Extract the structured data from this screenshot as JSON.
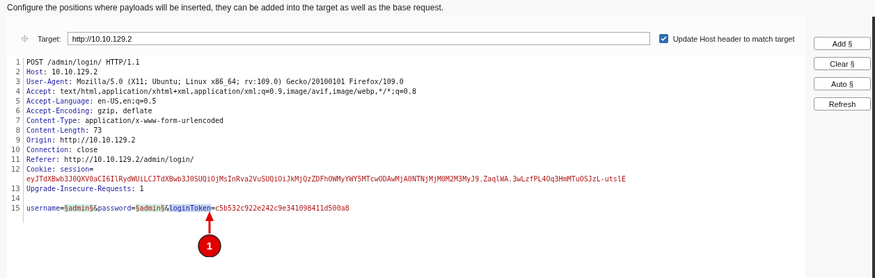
{
  "description": "Configure the positions where payloads will be inserted, they can be added into the target as well as the base request.",
  "target": {
    "label": "Target:",
    "value": "http://10.10.129.2"
  },
  "update_host": {
    "label": "Update Host header to match target",
    "checked": true
  },
  "buttons": [
    "Add §",
    "Clear §",
    "Auto §",
    "Refresh"
  ],
  "editor_lines": [
    {
      "number": "1",
      "segments": [
        {
          "kind": "plain",
          "text": "POST /admin/login/ HTTP/1.1"
        }
      ]
    },
    {
      "number": "2",
      "segments": [
        {
          "kind": "key",
          "text": "Host"
        },
        {
          "kind": "plain",
          "text": ": 10.10.129.2"
        }
      ]
    },
    {
      "number": "3",
      "segments": [
        {
          "kind": "key",
          "text": "User-Agent"
        },
        {
          "kind": "plain",
          "text": ": Mozilla/5.0 (X11; Ubuntu; Linux x86_64; rv:109.0) Gecko/20100101 Firefox/109.0"
        }
      ]
    },
    {
      "number": "4",
      "segments": [
        {
          "kind": "key",
          "text": "Accept"
        },
        {
          "kind": "plain",
          "text": ": text/html,application/xhtml+xml,application/xml;q=0.9,image/avif,image/webp,*/*;q=0.8"
        }
      ]
    },
    {
      "number": "5",
      "segments": [
        {
          "kind": "key",
          "text": "Accept-Language"
        },
        {
          "kind": "plain",
          "text": ": en-US,en;q=0.5"
        }
      ]
    },
    {
      "number": "6",
      "segments": [
        {
          "kind": "key",
          "text": "Accept-Encoding"
        },
        {
          "kind": "plain",
          "text": ": gzip, deflate"
        }
      ]
    },
    {
      "number": "7",
      "segments": [
        {
          "kind": "key",
          "text": "Content-Type"
        },
        {
          "kind": "plain",
          "text": ": application/x-www-form-urlencoded"
        }
      ]
    },
    {
      "number": "8",
      "segments": [
        {
          "kind": "key",
          "text": "Content-Length"
        },
        {
          "kind": "plain",
          "text": ": 73"
        }
      ]
    },
    {
      "number": "9",
      "segments": [
        {
          "kind": "key",
          "text": "Origin"
        },
        {
          "kind": "plain",
          "text": ": http://10.10.129.2"
        }
      ]
    },
    {
      "number": "10",
      "segments": [
        {
          "kind": "key",
          "text": "Connection"
        },
        {
          "kind": "plain",
          "text": ": close"
        }
      ]
    },
    {
      "number": "11",
      "segments": [
        {
          "kind": "key",
          "text": "Referer"
        },
        {
          "kind": "plain",
          "text": ": http://10.10.129.2/admin/login/"
        }
      ]
    },
    {
      "number": "12",
      "segments": [
        {
          "kind": "key",
          "text": "Cookie"
        },
        {
          "kind": "plain",
          "text": ": "
        },
        {
          "kind": "param",
          "text": "session"
        },
        {
          "kind": "plain",
          "text": "="
        }
      ]
    },
    {
      "segments": [
        {
          "kind": "value",
          "text": "eyJTdXBwb3J0QXV0aCI6IlRydWUiLCJTdXBwb3J0SUQiOjMsInRva2VuSUQiOiJkMjQzZDFhOWMyYWY5MTcwODAwMjA0NTNjMjM0M2M3MyJ9.ZaqlWA.3wLzfPL4Oq3HmMTuOSJzL-utslE"
        }
      ]
    },
    {
      "number": "13",
      "segments": [
        {
          "kind": "key",
          "text": "Upgrade-Insecure-Requests"
        },
        {
          "kind": "plain",
          "text": ": 1"
        }
      ]
    },
    {
      "number": "14"
    },
    {
      "number": "15",
      "segments": [
        {
          "kind": "param",
          "text": "username"
        },
        {
          "kind": "plain",
          "text": "="
        },
        {
          "kind": "payload",
          "text": "§admin§"
        },
        {
          "kind": "plain",
          "text": "&"
        },
        {
          "kind": "param",
          "text": "password"
        },
        {
          "kind": "plain",
          "text": "="
        },
        {
          "kind": "payload",
          "text": "§admin§"
        },
        {
          "kind": "plain",
          "text": "&"
        },
        {
          "kind": "selected",
          "text": "loginToken"
        },
        {
          "kind": "plain",
          "text": "="
        },
        {
          "kind": "value",
          "text": "c5b532c922e242c9e341098411d500a8"
        }
      ]
    }
  ],
  "callout": {
    "label": "1"
  }
}
